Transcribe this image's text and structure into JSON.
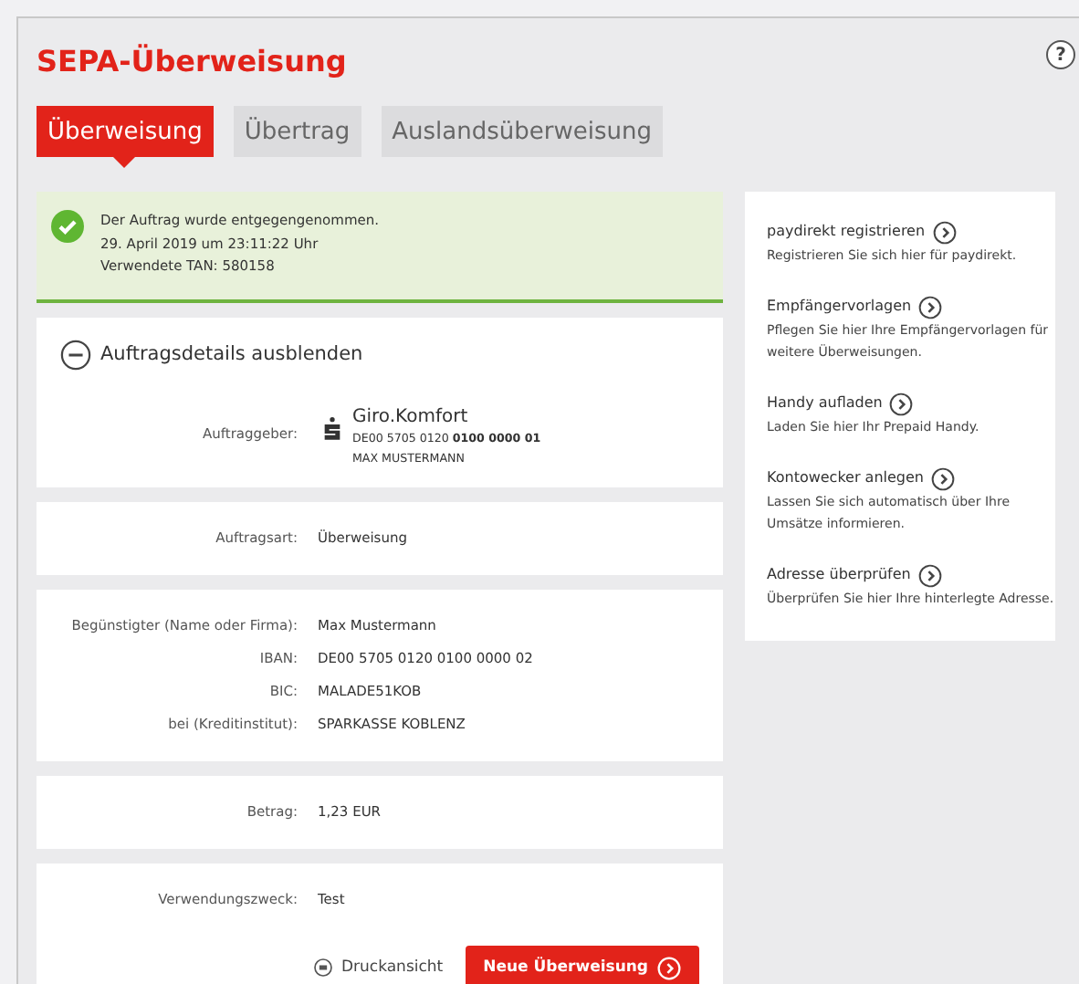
{
  "title": "SEPA-Überweisung",
  "help": "?",
  "tabs": [
    {
      "label": "Überweisung",
      "selected": true
    },
    {
      "label": "Übertrag",
      "selected": false
    },
    {
      "label": "Auslandsüberweisung",
      "selected": false
    }
  ],
  "confirmation": {
    "lines": [
      "Der Auftrag wurde entgegengenommen.",
      "29. April 2019 um 23:11:22 Uhr",
      "Verwendete TAN: 580158"
    ]
  },
  "details_toggle": {
    "label": "Auftragsdetails ausblenden",
    "expanded": true
  },
  "account": {
    "label": "Auftraggeber:",
    "name": "Giro.Komfort",
    "iban_prefix": "DE00 5705 0120 ",
    "iban_rest": "0100 0000 01",
    "holder": "MAX MUSTERMANN"
  },
  "sections": [
    {
      "rows": [
        {
          "label": "Auftragsart:",
          "value": "Überweisung"
        }
      ]
    },
    {
      "rows": [
        {
          "label": "Begünstigter (Name oder Firma):",
          "value": "Max Mustermann"
        },
        {
          "label": "IBAN:",
          "value": "DE00 5705 0120 0100 0000 02"
        },
        {
          "label": "BIC:",
          "value": "MALADE51KOB"
        },
        {
          "label": "bei (Kreditinstitut):",
          "value": "SPARKASSE KOBLENZ"
        }
      ]
    },
    {
      "rows": [
        {
          "label": "Betrag:",
          "value": "1,23 EUR"
        }
      ]
    },
    {
      "rows": [
        {
          "label": "Verwendungszweck:",
          "value": "Test"
        }
      ]
    }
  ],
  "print_link": "Druckansicht",
  "primary_button": "Neue Überweisung",
  "sidebar": [
    {
      "title": "paydirekt registrieren",
      "text": "Registrieren Sie sich hier für paydirekt."
    },
    {
      "title": "Empfängervorlagen",
      "text": "Pflegen Sie hier Ihre Empfängervorlagen für weitere Überweisungen."
    },
    {
      "title": "Handy aufladen",
      "text": "Laden Sie hier Ihr Prepaid Handy."
    },
    {
      "title": "Kontowecker anlegen",
      "text": "Lassen Sie sich automatisch über Ihre Umsätze informieren."
    },
    {
      "title": "Adresse überprüfen",
      "text": "Überprüfen Sie hier Ihre hinterlegte Adresse."
    }
  ]
}
